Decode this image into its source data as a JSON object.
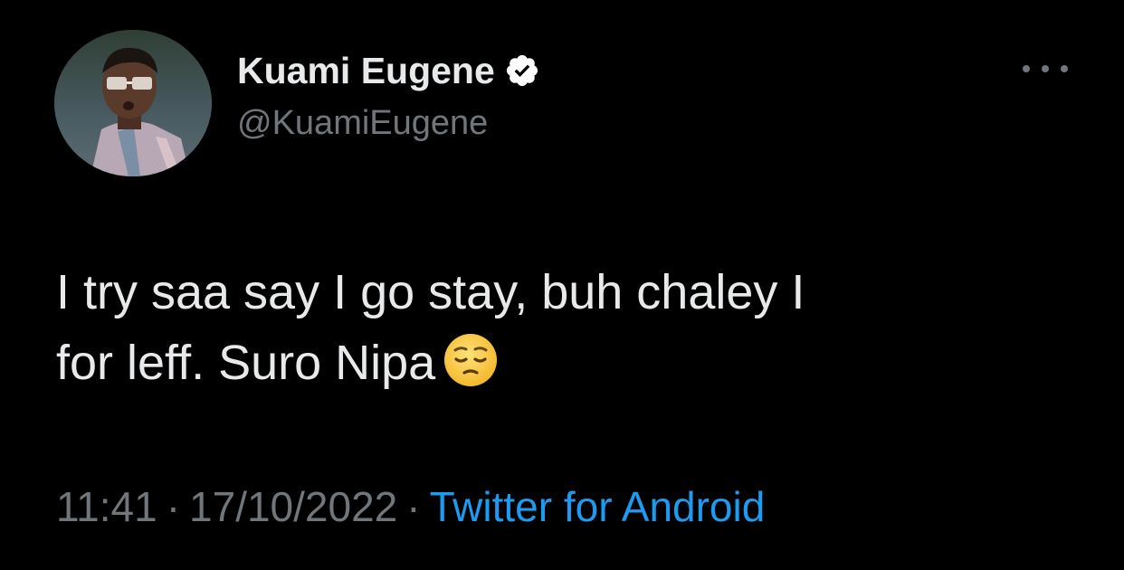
{
  "tweet": {
    "author": {
      "display_name": "Kuami Eugene",
      "handle": "@KuamiEugene",
      "verified": true,
      "avatar_icon": "profile-photo"
    },
    "text_line1": "I try saa say I go stay, buh chaley I",
    "text_line2": "for leff. Suro Nipa",
    "emoji_icon": "pensive-face-emoji",
    "meta": {
      "time": "11:41",
      "separator": "·",
      "date": "17/10/2022",
      "source": "Twitter for Android"
    },
    "more_icon": "more-horizontal-icon"
  },
  "colors": {
    "background": "#000000",
    "primary_text": "#e7e9ea",
    "secondary_text": "#71767b",
    "link": "#1d9bf0",
    "verified_badge": "#ffffff"
  }
}
